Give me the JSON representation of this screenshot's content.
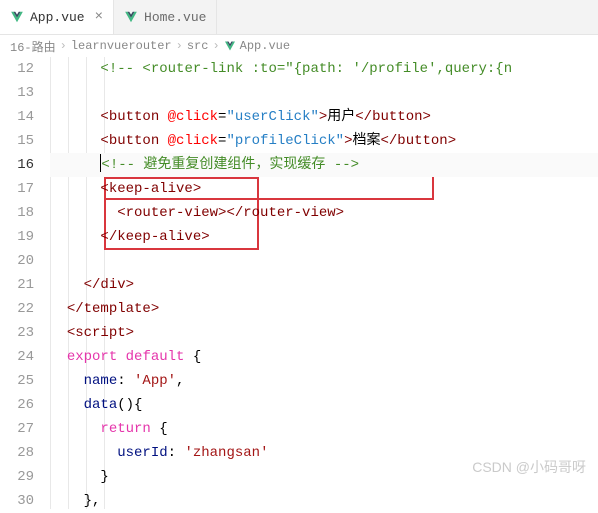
{
  "tabs": [
    {
      "label": "App.vue",
      "active": true
    },
    {
      "label": "Home.vue",
      "active": false
    }
  ],
  "breadcrumb": {
    "p1": "16-路由",
    "p2": "learnvuerouter",
    "p3": "src",
    "p4": "App.vue"
  },
  "lines": {
    "l12a": "<!--",
    "l12b": " <router-link :to=\"{path: '/profile',query:{n",
    "l14_btn": "<button",
    "l14_at": " @click",
    "l14_eq": "=",
    "l14_val": "\"userClick\"",
    "l14_close": ">",
    "l14_txt": "用户",
    "l14_end": "</button>",
    "l15_val": "\"profileClick\"",
    "l15_txt": "档案",
    "l16_cursor": "|",
    "l16_a": "<!--",
    "l16_b": " 避免重复创建组件，实现缓存 ",
    "l16_c": "-->",
    "l17": "<keep-alive>",
    "l18a": "<router-view>",
    "l18b": "</router-view>",
    "l19": "</keep-alive>",
    "l21": "</div>",
    "l22": "</template>",
    "l23": "<script>",
    "l24a": "export",
    "l24b": " default",
    "l24c": " {",
    "l25a": "name",
    "l25b": ": ",
    "l25c": "'App'",
    "l25d": ",",
    "l26a": "data",
    "l26b": "(){",
    "l27a": "return",
    "l27b": " {",
    "l28a": "userId",
    "l28b": ": ",
    "l28c": "'zhangsan'",
    "l29": "}",
    "l30": "},"
  },
  "watermark": "CSDN @小码哥呀"
}
